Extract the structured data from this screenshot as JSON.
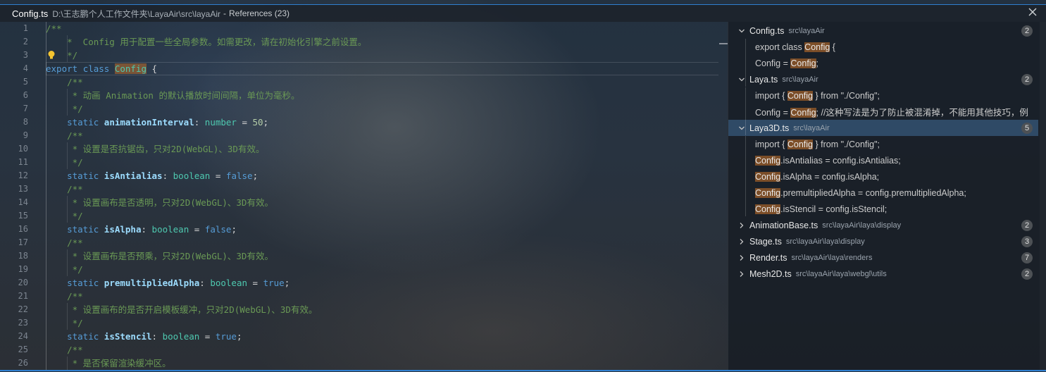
{
  "title_bar": {
    "file": "Config.ts",
    "path": "D:\\王志鹏个人工作文件夹\\LayaAir\\src\\layaAir",
    "separator": "-",
    "references": "References (23)",
    "close_icon": "close-icon"
  },
  "editor": {
    "line_numbers": [
      "1",
      "2",
      "3",
      "4",
      "5",
      "6",
      "7",
      "8",
      "9",
      "10",
      "11",
      "12",
      "13",
      "14",
      "15",
      "16",
      "17",
      "18",
      "19",
      "20",
      "21",
      "22",
      "23",
      "24",
      "25",
      "26"
    ],
    "lines": {
      "l1": "/**",
      "l2": "    *  Config 用于配置一些全局参数。如需更改，请在初始化引擎之前设置。",
      "l3": "    */",
      "l4_kw1": "export",
      "l4_kw2": "class",
      "l4_name": "Config",
      "l4_brace": " {",
      "l5": "    /**",
      "l6": "     * 动画 Animation 的默认播放时间间隔，单位为毫秒。",
      "l7": "     */",
      "l8_kw": "static",
      "l8_prop": "animationInterval",
      "l8_type": "number",
      "l8_val": "50",
      "l9": "    /**",
      "l10": "     * 设置是否抗锯齿，只对2D(WebGL)、3D有效。",
      "l11": "     */",
      "l12_kw": "static",
      "l12_prop": "isAntialias",
      "l12_type": "boolean",
      "l12_val": "false",
      "l13": "    /**",
      "l14": "     * 设置画布是否透明，只对2D(WebGL)、3D有效。",
      "l15": "     */",
      "l16_kw": "static",
      "l16_prop": "isAlpha",
      "l16_type": "boolean",
      "l16_val": "false",
      "l17": "    /**",
      "l18": "     * 设置画布是否预乘，只对2D(WebGL)、3D有效。",
      "l19": "     */",
      "l20_kw": "static",
      "l20_prop": "premultipliedAlpha",
      "l20_type": "boolean",
      "l20_val": "true",
      "l21": "    /**",
      "l22": "     * 设置画布的是否开启模板缓冲，只对2D(WebGL)、3D有效。",
      "l23": "     */",
      "l24_kw": "static",
      "l24_prop": "isStencil",
      "l24_type": "boolean",
      "l24_val": "true",
      "l25": "    /**",
      "l26": "     * 是否保留渲染缓冲区。"
    },
    "lightbulb_icon": "lightbulb-icon"
  },
  "references_panel": {
    "groups": [
      {
        "file": "Config.ts",
        "path": "src\\layaAir",
        "count": "2",
        "expanded": true,
        "matches": [
          {
            "pre": "export class ",
            "hit": "Config",
            "post": " {"
          },
          {
            "pre": "Config = ",
            "hit": "Config",
            "post": ";"
          }
        ]
      },
      {
        "file": "Laya.ts",
        "path": "src\\layaAir",
        "count": "2",
        "expanded": true,
        "matches": [
          {
            "pre": "import { ",
            "hit": "Config",
            "post": " } from \"./Config\";"
          },
          {
            "pre": "Config = ",
            "hit": "Config",
            "post": "; //这种写法是为了防止被混淆掉，不能用其他技巧，例"
          }
        ]
      },
      {
        "file": "Laya3D.ts",
        "path": "src\\layaAir",
        "count": "5",
        "expanded": true,
        "selected": true,
        "matches": [
          {
            "pre": "import { ",
            "hit": "Config",
            "post": " } from \"./Config\";"
          },
          {
            "pre": "",
            "hit": "Config",
            "post": ".isAntialias = config.isAntialias;"
          },
          {
            "pre": "",
            "hit": "Config",
            "post": ".isAlpha = config.isAlpha;"
          },
          {
            "pre": "",
            "hit": "Config",
            "post": ".premultipliedAlpha = config.premultipliedAlpha;"
          },
          {
            "pre": "",
            "hit": "Config",
            "post": ".isStencil = config.isStencil;"
          }
        ]
      },
      {
        "file": "AnimationBase.ts",
        "path": "src\\layaAir\\laya\\display",
        "count": "2",
        "expanded": false
      },
      {
        "file": "Stage.ts",
        "path": "src\\layaAir\\laya\\display",
        "count": "3",
        "expanded": false
      },
      {
        "file": "Render.ts",
        "path": "src\\layaAir\\laya\\renders",
        "count": "7",
        "expanded": false
      },
      {
        "file": "Mesh2D.ts",
        "path": "src\\layaAir\\laya\\webgl\\utils",
        "count": "2",
        "expanded": false
      }
    ]
  },
  "colors": {
    "accent": "#2f7fd0",
    "highlight": "#be6e28",
    "selection": "#2f4a66"
  }
}
